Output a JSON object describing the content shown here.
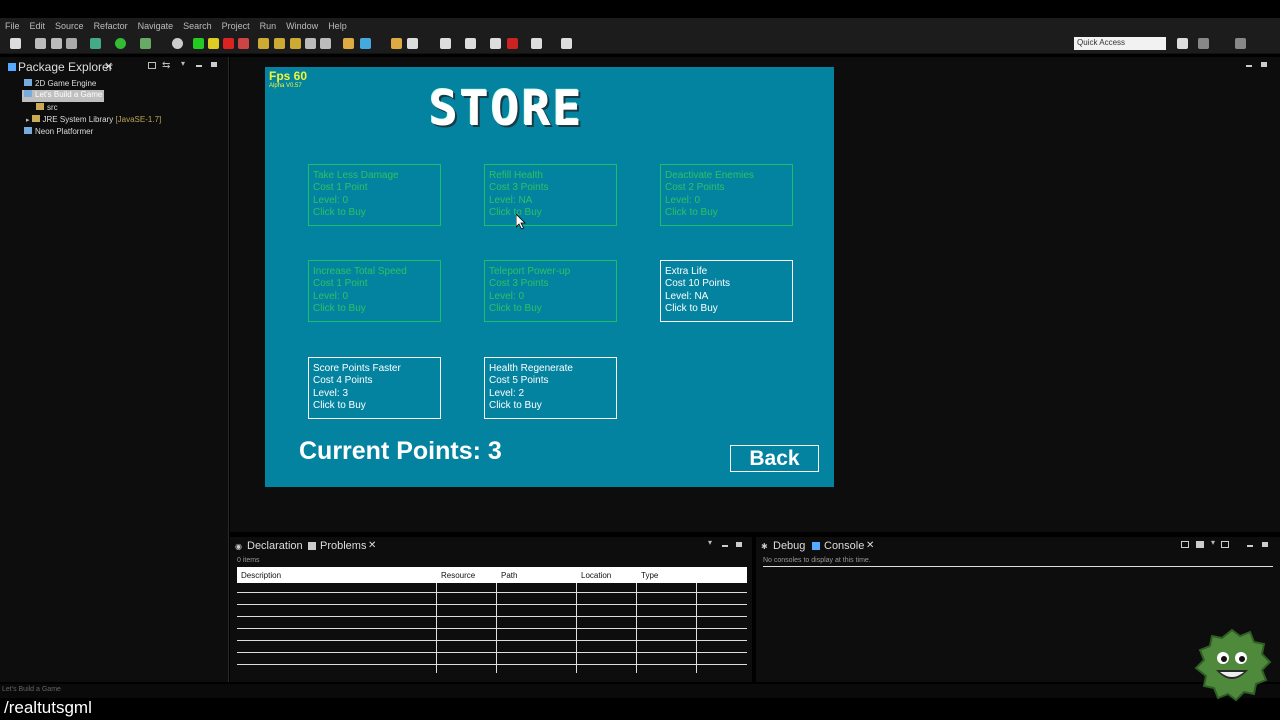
{
  "menu": [
    "File",
    "Edit",
    "Source",
    "Refactor",
    "Navigate",
    "Search",
    "Project",
    "Run",
    "Window",
    "Help"
  ],
  "quick_access": "Quick Access",
  "package_explorer": {
    "title": "Package Explorer",
    "items": [
      {
        "label": "2D Game Engine"
      },
      {
        "label": "Let's Build a Game"
      },
      {
        "label": "src"
      },
      {
        "label": "JRE System Library",
        "detail": "[JavaSE-1.7]"
      },
      {
        "label": "Neon Platformer"
      }
    ]
  },
  "game": {
    "fps": "Fps 60",
    "version": "Alpha V0.57",
    "title": "STORE",
    "cards": [
      {
        "name": "Take Less Damage",
        "cost": "Cost 1 Point",
        "level": "Level: 0",
        "action": "Click to Buy",
        "state": "locked"
      },
      {
        "name": "Refill Health",
        "cost": "Cost 3 Points",
        "level": "Level: NA",
        "action": "Click to Buy",
        "state": "locked"
      },
      {
        "name": "Deactivate Enemies",
        "cost": "Cost 2 Points",
        "level": "Level: 0",
        "action": "Click to Buy",
        "state": "locked"
      },
      {
        "name": "Increase Total Speed",
        "cost": "Cost 1 Point",
        "level": "Level: 0",
        "action": "Click to Buy",
        "state": "locked"
      },
      {
        "name": "Teleport Power-up",
        "cost": "Cost 3 Points",
        "level": "Level: 0",
        "action": "Click to Buy",
        "state": "locked"
      },
      {
        "name": "Extra Life",
        "cost": "Cost 10 Points",
        "level": "Level: NA",
        "action": "Click to Buy",
        "state": "open"
      },
      {
        "name": "Score Points Faster",
        "cost": "Cost 4 Points",
        "level": "Level: 3",
        "action": "Click to Buy",
        "state": "open"
      },
      {
        "name": "Health Regenerate",
        "cost": "Cost 5 Points",
        "level": "Level: 2",
        "action": "Click to Buy",
        "state": "open"
      }
    ],
    "points": "Current Points: 3",
    "back": "Back"
  },
  "problems_panel": {
    "tab_declaration": "Declaration",
    "tab_problems": "Problems",
    "items_count": "0 items",
    "columns": [
      "Description",
      "Resource",
      "Path",
      "Location",
      "Type"
    ]
  },
  "console_panel": {
    "tab_debug": "Debug",
    "tab_console": "Console",
    "message": "No consoles to display at this time."
  },
  "status_bar": "Let's Build a Game",
  "watermark": "/realtutsgml",
  "colors": {
    "game_bg": "#0483a1",
    "locked_text": "#2fc25f",
    "fps_text": "#f1f53a"
  }
}
